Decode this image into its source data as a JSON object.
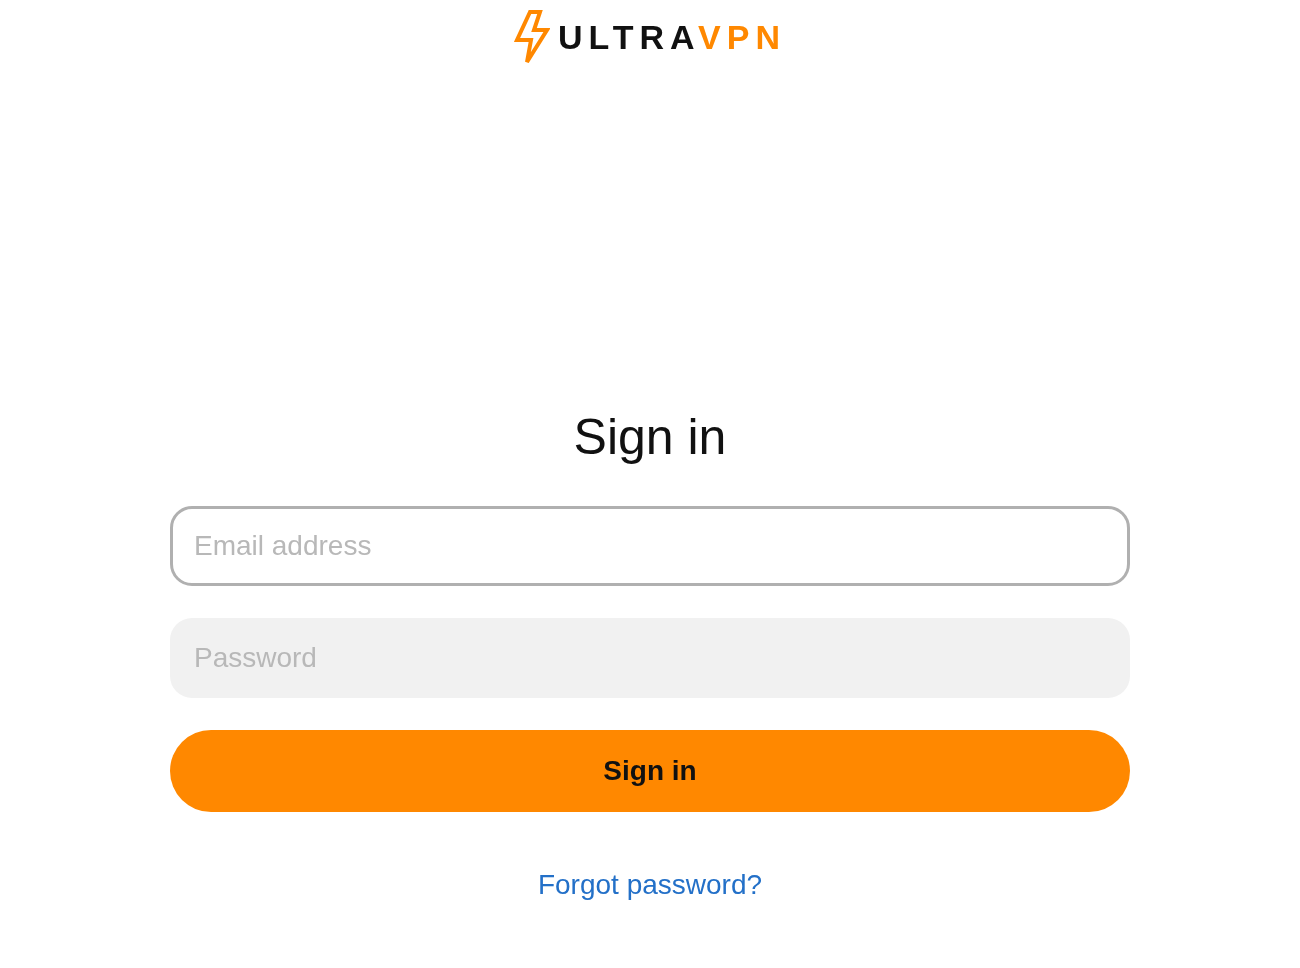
{
  "logo": {
    "text": "ULTRA",
    "accent": "VPN"
  },
  "title": "Sign in",
  "fields": [
    {
      "placeholder": "Email address",
      "focused": true
    },
    {
      "placeholder": "Password",
      "focused": false
    }
  ],
  "submit": "Sign in",
  "forgot_link": "Forgot password?"
}
